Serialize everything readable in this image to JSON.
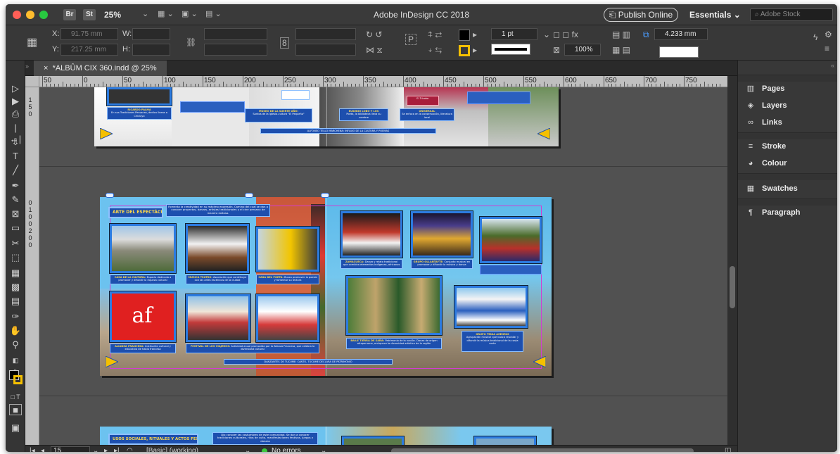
{
  "window": {
    "title": "Adobe InDesign CC 2018",
    "zoom": "25%",
    "bridge_badge": "Br",
    "stock_badge": "St",
    "publish_label": "Publish Online",
    "workspace_label": "Essentials",
    "search_placeholder": "Adobe Stock"
  },
  "control_panel": {
    "x_label": "X:",
    "x_value": "91.75 mm",
    "y_label": "Y:",
    "y_value": "217.25 mm",
    "w_label": "W:",
    "h_label": "H:",
    "stroke_weight": "1 pt",
    "opacity": "100%",
    "offset_value": "4.233 mm",
    "fill_color": "#000000",
    "stroke_color": "#f5c000"
  },
  "document": {
    "tab_label": "*ALBÛM CIX 360.indd @ 25%",
    "close_label": "×"
  },
  "ruler": {
    "h_labels": [
      "50",
      "0",
      "50",
      "100",
      "150",
      "200",
      "250",
      "300",
      "350",
      "400",
      "450",
      "500",
      "550",
      "600",
      "650",
      "700",
      "750"
    ],
    "v_labels_spread1": [
      "1",
      "5",
      "0"
    ],
    "v_labels_spread2": [
      "0",
      "1",
      "0",
      "0",
      "2",
      "0",
      "0"
    ]
  },
  "spread1": {
    "top_captions": [
      {
        "title": "RICARDO PALMA",
        "text": "En sus Tradiciones Peruanas, dedica líneas a Chiclayo"
      },
      {
        "title": "MUSEO DE LA SUERTE-AÑO:",
        "text": "Santos de la iglesia-cultura \"El Pequeño\""
      },
      {
        "title": "EUSEBIO LOBO Y LOS",
        "text": "Poeta, la biblioteca lleva su nombre"
      },
      {
        "title": "UNIVERSAL",
        "text": "Se enfoca en la conservación, literatura local"
      }
    ],
    "banner": "ALFONSO TELLO MARCHENA: INFLUJO DE LA CULTURA Y POEMAS",
    "mini_label": "El Tricolor"
  },
  "spread2": {
    "section_title": "ARTE DEL ESPECTÁCULO",
    "intro_text": "Fomenta la creatividad en su máximo expresión. Camino del cual se dan a conocer proyectos, danzas, artistas tradicionales y el cine peruano de manera exitosa.",
    "captions": [
      {
        "title": "CASA DE LA CULTURA:",
        "text": "Espacio dedicado a promover y difundir la riqueza cultural"
      },
      {
        "title": "MUSICA TEATRO:",
        "text": "Asociación que contribuye con las artes escénicas de la ciudad"
      },
      {
        "title": "CASA DEL POETA:",
        "text": "Busca promover la poesía y fomentar su lectura"
      },
      {
        "title": "ALIANZA FRANCESA:",
        "text": "Institución cultural y educativa de habla francesa"
      },
      {
        "title": "FESTIVAL DE LOS VIAJEROS:",
        "text": "Actividad anual promovida por la Alianza Francesa, que celebra la diversidad cultural"
      },
      {
        "title": "ZAMACUECA:",
        "text": "Danza y relato tradicional que combina elementos indígenas, africanos"
      },
      {
        "title": "GRUPO OLLANTAYTE:",
        "text": "Conjunto musical en promover y difundir la música y danza"
      },
      {
        "title": "BAILE TIERRA DE SAÑA:",
        "text": "Patrimonio de la nación. Danza de origen afroperuano, enriquece la diversidad artística de la región"
      },
      {
        "title": "GRUPO TENIA AZENTAS",
        "text": "Agrupación musical que busca rescatar y difundir la música tradicional de la costa norte"
      }
    ],
    "bottom_banner": "DANZANTES DE TÚCUME: CANTO, TÚCUME DECLARA DE PATRIMONIO"
  },
  "spread3": {
    "section_title": "USOS SOCIALES, RITUALES Y ACTOS FESTIVOS",
    "intro_text": "Dio conocer las costumbres de este comunidad. Se dan a conocer tradiciones culturales, ritos de culto, manifestaciones festivas, juegos y danzas"
  },
  "panels": [
    {
      "label": "Pages",
      "icon": "pages-icon"
    },
    {
      "label": "Layers",
      "icon": "layers-icon"
    },
    {
      "label": "Links",
      "icon": "links-icon"
    },
    {
      "label": "Stroke",
      "icon": "stroke-icon"
    },
    {
      "label": "Colour",
      "icon": "colour-icon"
    },
    {
      "label": "Swatches",
      "icon": "swatches-icon"
    },
    {
      "label": "Paragraph",
      "icon": "paragraph-icon"
    }
  ],
  "status": {
    "page": "15",
    "style": "[Basic] (working)",
    "errors": "No errors"
  }
}
